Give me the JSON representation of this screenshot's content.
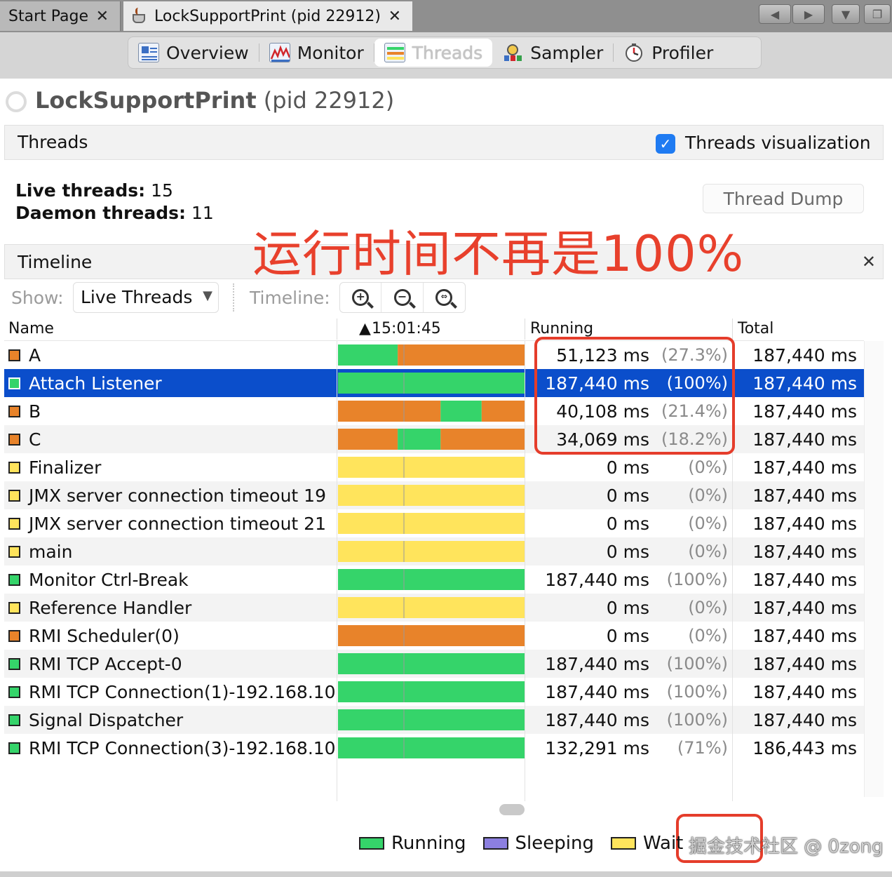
{
  "tabs": {
    "start": "Start Page",
    "active": "LockSupportPrint (pid 22912)",
    "close_glyph": "✕"
  },
  "views": [
    {
      "label": "Overview",
      "icon": "overview-icon"
    },
    {
      "label": "Monitor",
      "icon": "monitor-chart-icon"
    },
    {
      "label": "Threads",
      "icon": "threads-icon",
      "selected": true
    },
    {
      "label": "Sampler",
      "icon": "sampler-icon"
    },
    {
      "label": "Profiler",
      "icon": "profiler-clock-icon"
    }
  ],
  "app_title": {
    "name": "LockSupportPrint",
    "pid": "(pid 22912)"
  },
  "threads_panel": {
    "title": "Threads",
    "visualization_label": "Threads visualization",
    "visualization_checked": true,
    "live_label": "Live threads:",
    "live_value": "15",
    "daemon_label": "Daemon threads:",
    "daemon_value": "11",
    "dump_button": "Thread Dump"
  },
  "annotation": "运行时间不再是100%",
  "timeline_panel": {
    "title": "Timeline",
    "close_glyph": "✕",
    "show_label": "Show:",
    "show_value": "Live Threads",
    "timeline_label": "Timeline:"
  },
  "table": {
    "columns": {
      "name": "Name",
      "time": "15:01:45",
      "running": "Running",
      "total": "Total"
    },
    "rows": [
      {
        "name": "A",
        "swatch": "#e8832a",
        "segments": [
          [
            "running",
            0.32
          ],
          [
            "monitor",
            0.68
          ]
        ],
        "running": "51,123 ms",
        "pct": "(27.3%)",
        "total": "187,440 ms"
      },
      {
        "name": "Attach Listener",
        "swatch": "#35d46a",
        "selected": true,
        "segments": [
          [
            "running",
            1.0
          ]
        ],
        "running": "187,440 ms",
        "pct": "(100%)",
        "total": "187,440 ms"
      },
      {
        "name": "B",
        "swatch": "#e8832a",
        "segments": [
          [
            "monitor",
            0.55
          ],
          [
            "running",
            0.22
          ],
          [
            "monitor",
            0.23
          ]
        ],
        "running": "40,108 ms",
        "pct": "(21.4%)",
        "total": "187,440 ms"
      },
      {
        "name": "C",
        "swatch": "#e8832a",
        "segments": [
          [
            "monitor",
            0.32
          ],
          [
            "running",
            0.23
          ],
          [
            "monitor",
            0.45
          ]
        ],
        "running": "34,069 ms",
        "pct": "(18.2%)",
        "total": "187,440 ms"
      },
      {
        "name": "Finalizer",
        "swatch": "#ffe45c",
        "segments": [
          [
            "wait",
            1.0
          ]
        ],
        "running": "0 ms",
        "pct": "(0%)",
        "total": "187,440 ms"
      },
      {
        "name": "JMX server connection timeout 19",
        "swatch": "#ffe45c",
        "segments": [
          [
            "wait",
            1.0
          ]
        ],
        "running": "0 ms",
        "pct": "(0%)",
        "total": "187,440 ms"
      },
      {
        "name": "JMX server connection timeout 21",
        "swatch": "#ffe45c",
        "segments": [
          [
            "wait",
            1.0
          ]
        ],
        "running": "0 ms",
        "pct": "(0%)",
        "total": "187,440 ms"
      },
      {
        "name": "main",
        "swatch": "#ffe45c",
        "segments": [
          [
            "wait",
            1.0
          ]
        ],
        "running": "0 ms",
        "pct": "(0%)",
        "total": "187,440 ms"
      },
      {
        "name": "Monitor Ctrl-Break",
        "swatch": "#35d46a",
        "segments": [
          [
            "running",
            1.0
          ]
        ],
        "running": "187,440 ms",
        "pct": "(100%)",
        "total": "187,440 ms"
      },
      {
        "name": "Reference Handler",
        "swatch": "#ffe45c",
        "segments": [
          [
            "wait",
            1.0
          ]
        ],
        "running": "0 ms",
        "pct": "(0%)",
        "total": "187,440 ms"
      },
      {
        "name": "RMI Scheduler(0)",
        "swatch": "#e8832a",
        "segments": [
          [
            "monitor",
            1.0
          ]
        ],
        "running": "0 ms",
        "pct": "(0%)",
        "total": "187,440 ms"
      },
      {
        "name": "RMI TCP Accept-0",
        "swatch": "#35d46a",
        "segments": [
          [
            "running",
            1.0
          ]
        ],
        "running": "187,440 ms",
        "pct": "(100%)",
        "total": "187,440 ms"
      },
      {
        "name": "RMI TCP Connection(1)-192.168.10",
        "swatch": "#35d46a",
        "segments": [
          [
            "running",
            1.0
          ]
        ],
        "running": "187,440 ms",
        "pct": "(100%)",
        "total": "187,440 ms"
      },
      {
        "name": "Signal Dispatcher",
        "swatch": "#35d46a",
        "segments": [
          [
            "running",
            1.0
          ]
        ],
        "running": "187,440 ms",
        "pct": "(100%)",
        "total": "187,440 ms"
      },
      {
        "name": "RMI TCP Connection(3)-192.168.10",
        "swatch": "#35d46a",
        "segments": [
          [
            "running",
            1.0
          ]
        ],
        "running": "132,291 ms",
        "pct": "(71%)",
        "total": "186,443 ms"
      }
    ]
  },
  "state_colors": {
    "running": "#35d46a",
    "sleeping": "#8c7fe0",
    "wait": "#ffe45c",
    "park": "#e8832a",
    "monitor": "#e8832a"
  },
  "legend": [
    {
      "label": "Running",
      "color": "#35d46a"
    },
    {
      "label": "Sleeping",
      "color": "#8c7fe0"
    },
    {
      "label": "Wait",
      "color": "#ffe45c"
    }
  ],
  "watermark": "掘金技术社区 @ 0zong"
}
